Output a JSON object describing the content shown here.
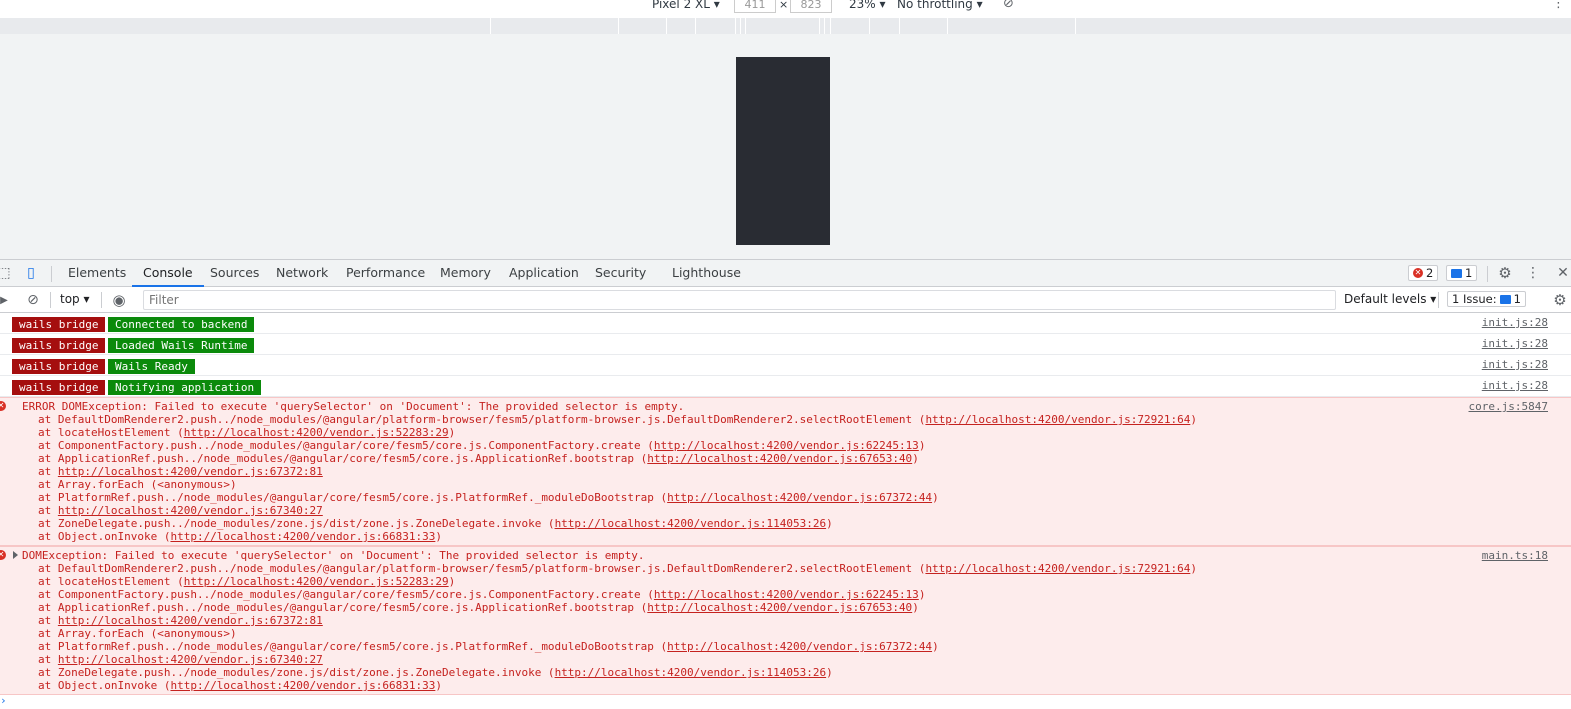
{
  "device_toolbar": {
    "device": "Pixel 2 XL",
    "width": "411",
    "times": "×",
    "height": "823",
    "zoom": "23%",
    "throttle": "No throttling"
  },
  "devtools_tabs": [
    "Elements",
    "Console",
    "Sources",
    "Network",
    "Performance",
    "Memory",
    "Application",
    "Security",
    "Lighthouse"
  ],
  "tab_badges": {
    "errors": "2",
    "messages": "1"
  },
  "console_toolbar": {
    "context": "top",
    "filter_placeholder": "Filter",
    "levels": "Default levels",
    "issues_label": "1 Issue:",
    "issues_count": "1"
  },
  "logs": [
    {
      "tag": "wails bridge",
      "text": "Connected to backend",
      "source": "init.js:28"
    },
    {
      "tag": "wails bridge",
      "text": "Loaded Wails Runtime",
      "source": "init.js:28"
    },
    {
      "tag": "wails bridge",
      "text": "Wails Ready",
      "source": "init.js:28"
    },
    {
      "tag": "wails bridge",
      "text": "Notifying application",
      "source": "init.js:28"
    }
  ],
  "errors": [
    {
      "message": "ERROR DOMException: Failed to execute 'querySelector' on 'Document': The provided selector is empty.",
      "source": "core.js:5847",
      "stack": [
        {
          "fn": "at DefaultDomRenderer2.push../node_modules/@angular/platform-browser/fesm5/platform-browser.js.DefaultDomRenderer2.selectRootElement (",
          "url": "http://localhost:4200/vendor.js:72921:64",
          "tail": ")"
        },
        {
          "fn": "at locateHostElement (",
          "url": "http://localhost:4200/vendor.js:52283:29",
          "tail": ")"
        },
        {
          "fn": "at ComponentFactory.push../node_modules/@angular/core/fesm5/core.js.ComponentFactory.create (",
          "url": "http://localhost:4200/vendor.js:62245:13",
          "tail": ")"
        },
        {
          "fn": "at ApplicationRef.push../node_modules/@angular/core/fesm5/core.js.ApplicationRef.bootstrap (",
          "url": "http://localhost:4200/vendor.js:67653:40",
          "tail": ")"
        },
        {
          "fn": "at ",
          "url": "http://localhost:4200/vendor.js:67372:81",
          "tail": ""
        },
        {
          "fn": "at Array.forEach (<anonymous>)",
          "url": "",
          "tail": ""
        },
        {
          "fn": "at PlatformRef.push../node_modules/@angular/core/fesm5/core.js.PlatformRef._moduleDoBootstrap (",
          "url": "http://localhost:4200/vendor.js:67372:44",
          "tail": ")"
        },
        {
          "fn": "at ",
          "url": "http://localhost:4200/vendor.js:67340:27",
          "tail": ""
        },
        {
          "fn": "at ZoneDelegate.push../node_modules/zone.js/dist/zone.js.ZoneDelegate.invoke (",
          "url": "http://localhost:4200/vendor.js:114053:26",
          "tail": ")"
        },
        {
          "fn": "at Object.onInvoke (",
          "url": "http://localhost:4200/vendor.js:66831:33",
          "tail": ")"
        }
      ]
    },
    {
      "message": "DOMException: Failed to execute 'querySelector' on 'Document': The provided selector is empty.",
      "source": "main.ts:18",
      "stack": [
        {
          "fn": "at DefaultDomRenderer2.push../node_modules/@angular/platform-browser/fesm5/platform-browser.js.DefaultDomRenderer2.selectRootElement (",
          "url": "http://localhost:4200/vendor.js:72921:64",
          "tail": ")"
        },
        {
          "fn": "at locateHostElement (",
          "url": "http://localhost:4200/vendor.js:52283:29",
          "tail": ")"
        },
        {
          "fn": "at ComponentFactory.push../node_modules/@angular/core/fesm5/core.js.ComponentFactory.create (",
          "url": "http://localhost:4200/vendor.js:62245:13",
          "tail": ")"
        },
        {
          "fn": "at ApplicationRef.push../node_modules/@angular/core/fesm5/core.js.ApplicationRef.bootstrap (",
          "url": "http://localhost:4200/vendor.js:67653:40",
          "tail": ")"
        },
        {
          "fn": "at ",
          "url": "http://localhost:4200/vendor.js:67372:81",
          "tail": ""
        },
        {
          "fn": "at Array.forEach (<anonymous>)",
          "url": "",
          "tail": ""
        },
        {
          "fn": "at PlatformRef.push../node_modules/@angular/core/fesm5/core.js.PlatformRef._moduleDoBootstrap (",
          "url": "http://localhost:4200/vendor.js:67372:44",
          "tail": ")"
        },
        {
          "fn": "at ",
          "url": "http://localhost:4200/vendor.js:67340:27",
          "tail": ""
        },
        {
          "fn": "at ZoneDelegate.push../node_modules/zone.js/dist/zone.js.ZoneDelegate.invoke (",
          "url": "http://localhost:4200/vendor.js:114053:26",
          "tail": ")"
        },
        {
          "fn": "at Object.onInvoke (",
          "url": "http://localhost:4200/vendor.js:66831:33",
          "tail": ")"
        }
      ]
    }
  ],
  "prompt_symbol": "›",
  "colors": {
    "tag_bg": "#a50e0e",
    "text_bg": "#0b8a0b",
    "error_bg": "#fdecec",
    "error_text": "#c5221f",
    "accent": "#1a73e8"
  }
}
